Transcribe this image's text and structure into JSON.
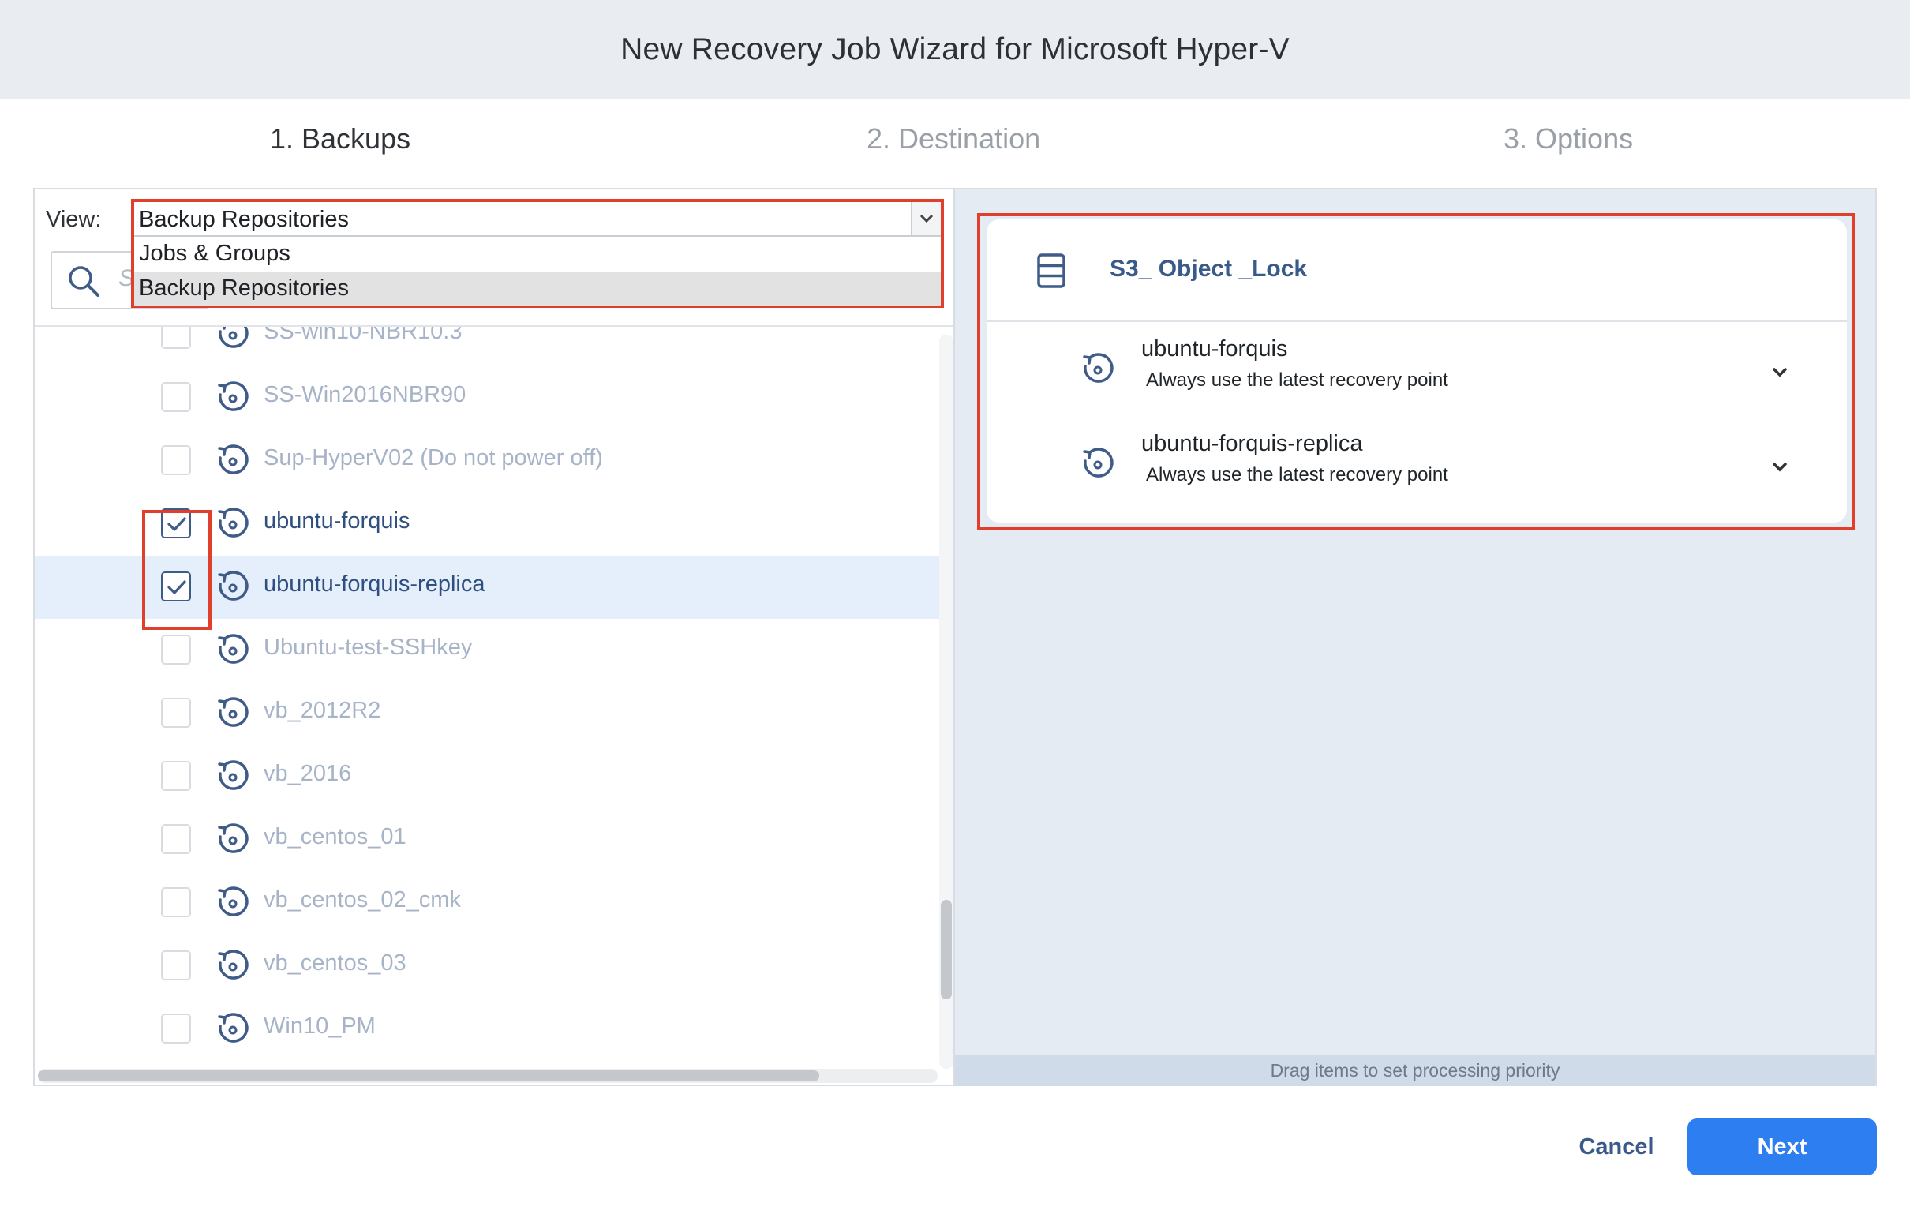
{
  "window": {
    "title": "New Recovery Job Wizard for Microsoft Hyper-V"
  },
  "steps": [
    {
      "label": "1. Backups",
      "active": true
    },
    {
      "label": "2. Destination",
      "active": false
    },
    {
      "label": "3. Options",
      "active": false
    }
  ],
  "view": {
    "label": "View:",
    "selected": "Backup Repositories",
    "options": [
      "Jobs & Groups",
      "Backup Repositories"
    ]
  },
  "search": {
    "placeholder": "S"
  },
  "list": {
    "items": [
      {
        "label": "SS-win10-NBR10.3",
        "checked": false
      },
      {
        "label": "SS-Win2016NBR90",
        "checked": false
      },
      {
        "label": "Sup-HyperV02 (Do not power off)",
        "checked": false
      },
      {
        "label": "ubuntu-forquis",
        "checked": true
      },
      {
        "label": "ubuntu-forquis-replica",
        "checked": true
      },
      {
        "label": "Ubuntu-test-SSHkey",
        "checked": false
      },
      {
        "label": "vb_2012R2",
        "checked": false
      },
      {
        "label": "vb_2016",
        "checked": false
      },
      {
        "label": "vb_centos_01",
        "checked": false
      },
      {
        "label": "vb_centos_02_cmk",
        "checked": false
      },
      {
        "label": "vb_centos_03",
        "checked": false
      },
      {
        "label": "Win10_PM",
        "checked": false
      }
    ]
  },
  "selection": {
    "repository": "S3_ Object _Lock",
    "items": [
      {
        "name": "ubuntu-forquis",
        "recovery_point": "Always use the latest recovery point"
      },
      {
        "name": "ubuntu-forquis-replica",
        "recovery_point": "Always use the latest recovery point"
      }
    ],
    "hint": "Drag items to set processing priority"
  },
  "footer": {
    "cancel_label": "Cancel",
    "next_label": "Next"
  },
  "colors": {
    "accent": "#2d7ef0",
    "link": "#3a5a8a",
    "highlight_frame": "#e0402b",
    "row_selected": "#e5effb"
  }
}
